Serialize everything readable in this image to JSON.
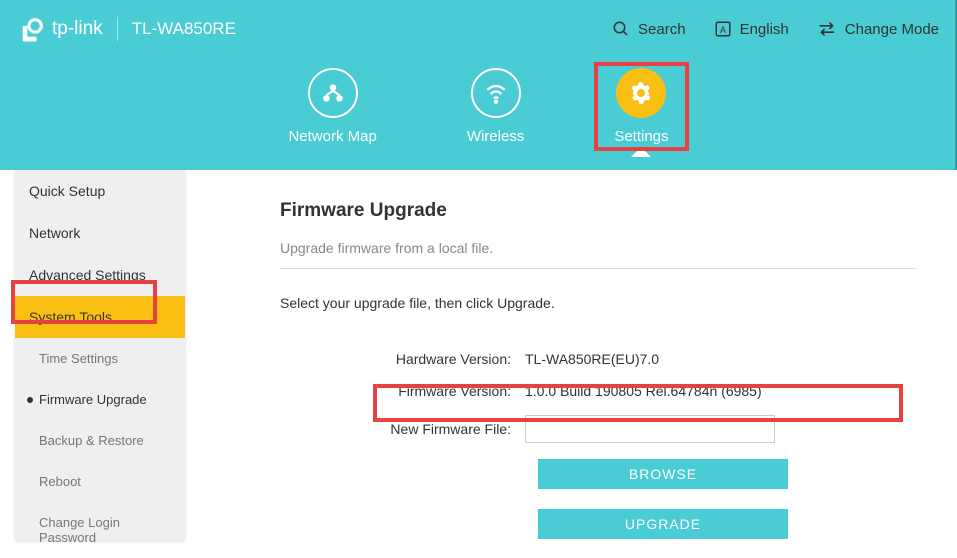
{
  "header": {
    "brand": "tp-link",
    "model": "TL-WA850RE",
    "search": "Search",
    "language": "English",
    "change_mode": "Change Mode"
  },
  "nav": {
    "network_map": "Network Map",
    "wireless": "Wireless",
    "settings": "Settings"
  },
  "sidebar": {
    "quick_setup": "Quick Setup",
    "network": "Network",
    "advanced": "Advanced Settings",
    "system_tools": "System Tools",
    "time": "Time Settings",
    "firmware": "Firmware Upgrade",
    "backup": "Backup & Restore",
    "reboot": "Reboot",
    "login": "Change Login Password"
  },
  "content": {
    "title": "Firmware Upgrade",
    "desc": "Upgrade firmware from a local file.",
    "instruction": "Select your upgrade file, then click Upgrade.",
    "hw_label": "Hardware Version:",
    "hw_value": "TL-WA850RE(EU)7.0",
    "fw_label": "Firmware Version:",
    "fw_value": "1.0.0 Build 190805 Rel.64784n (6985)",
    "file_label": "New Firmware File:",
    "file_value": "",
    "browse": "BROWSE",
    "upgrade": "UPGRADE"
  }
}
